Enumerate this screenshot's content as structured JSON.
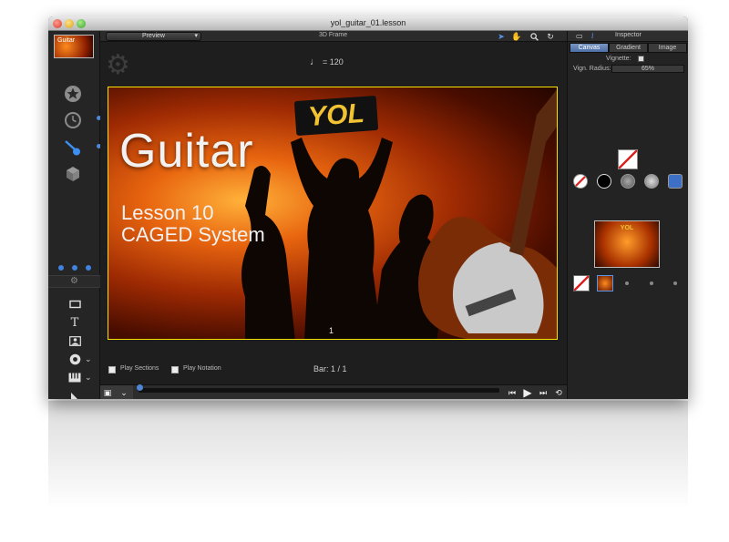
{
  "window": {
    "title": "yol_guitar_01.lesson"
  },
  "leftbar": {
    "thumb_label": "Guitar",
    "icons": [
      "star-icon",
      "clock-icon",
      "guitar-icon",
      "cube-icon"
    ],
    "tools": [
      "rectangle-tool-icon",
      "text-tool-icon",
      "image-tool-icon",
      "record-tool-icon",
      "keyboard-tool-icon",
      "export-tool-icon"
    ]
  },
  "toolbar": {
    "preview_label": "Preview",
    "frame_mode": "3D Frame"
  },
  "tempo": {
    "note_glyph": "♩",
    "label": "= 120"
  },
  "stage": {
    "title": "Guitar",
    "subtitle_line1": "Lesson 10",
    "subtitle_line2": "CAGED System",
    "sign_text": "YOL",
    "page_number": "1"
  },
  "transport": {
    "play_sections_label": "Play Sections",
    "play_notation_label": "Play Notation",
    "bar_readout": "Bar: 1 / 1"
  },
  "inspector": {
    "title": "Inspector",
    "tabs": [
      {
        "label": "Canvas",
        "active": true
      },
      {
        "label": "Gradient",
        "active": false
      },
      {
        "label": "Image",
        "active": false
      }
    ],
    "vignette_label": "Vignette:",
    "radius_label": "Vign. Radius:",
    "radius_value": "65%",
    "image_label": "YOL",
    "swatch_colors": [
      "#ffffff",
      "#000000",
      "#777777",
      "#aaaaaa",
      "#3d6fc4"
    ]
  },
  "colors": {
    "accent": "#4f86d6",
    "stage_border": "#f5e200",
    "sign_text": "#f1c232"
  }
}
